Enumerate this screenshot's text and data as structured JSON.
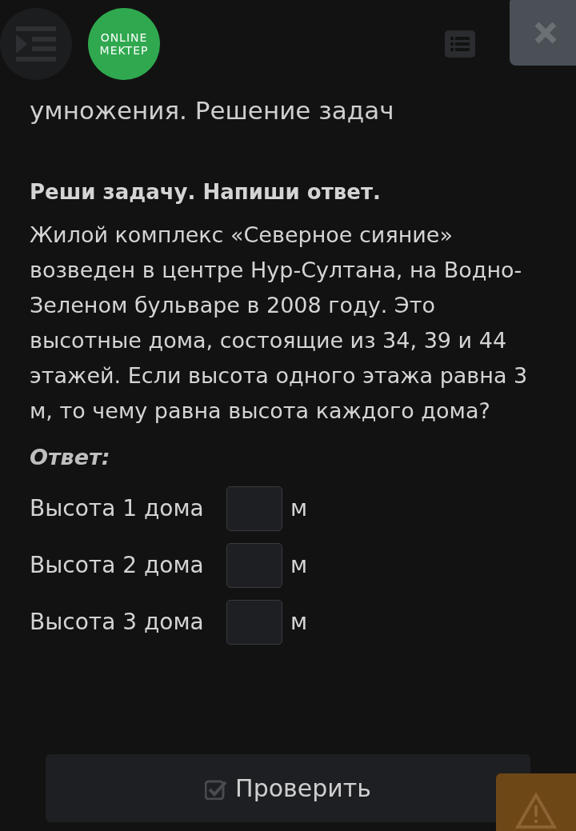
{
  "header": {
    "logo": [
      "ONLINE",
      "MEKTEP"
    ]
  },
  "title": "умножения. Решение задач",
  "task": {
    "heading": "Реши задачу. Напиши ответ.",
    "text": "Жилой комплекс «Северное сияние» возведен в центре Нур-Султана, на Водно-Зеленом бульваре в 2008 году. Это высотные дома, состоящие из 34, 39 и 44 этажей. Если высота одного этажа равна 3 м, то чему равна высота каждого дома?"
  },
  "answer_label": "Ответ:",
  "answers": [
    {
      "label": "Высота 1 дома",
      "unit": "м"
    },
    {
      "label": "Высота 2 дома",
      "unit": "м"
    },
    {
      "label": "Высота 3 дома",
      "unit": "м"
    }
  ],
  "check_button": "Проверить"
}
